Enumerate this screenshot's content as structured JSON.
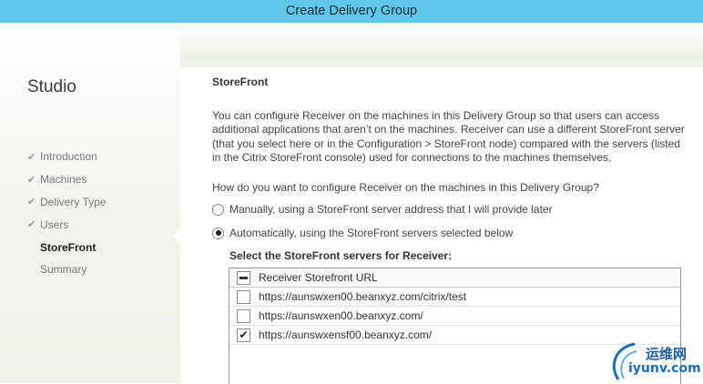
{
  "window": {
    "title": "Create Delivery Group"
  },
  "sidebar": {
    "app_name": "Studio",
    "steps": [
      {
        "label": "Introduction",
        "done": true
      },
      {
        "label": "Machines",
        "done": true
      },
      {
        "label": "Delivery Type",
        "done": true
      },
      {
        "label": "Users",
        "done": true
      },
      {
        "label": "StoreFront",
        "done": false,
        "current": true
      },
      {
        "label": "Summary",
        "done": false
      }
    ]
  },
  "main": {
    "section_title": "StoreFront",
    "description": "You can configure Receiver on the machines in this Delivery Group so that users can access additional applications that aren’t on the machines. Receiver can use a different StoreFront server (that you select here or in the Configuration > StoreFront node) compared with the servers (listed in the Citrix StoreFront console) used for connections to the machines themselves.",
    "question": "How do you want to configure Receiver on the machines in this Delivery Group?",
    "options": [
      {
        "label": "Manually, using a StoreFront server address that I will provide later",
        "selected": false
      },
      {
        "label": "Automatically, using the StoreFront servers selected below",
        "selected": true
      }
    ],
    "select_label": "Select the StoreFront servers for Receiver:",
    "list": {
      "header": "Receiver Storefront URL",
      "rows": [
        {
          "url": "https://aunswxen00.beanxyz.com/citrix/test",
          "checked": false
        },
        {
          "url": "https://aunswxen00.beanxyz.com/",
          "checked": false
        },
        {
          "url": "https://aunswxensf00.beanxyz.com/",
          "checked": true
        }
      ]
    }
  },
  "watermark": {
    "cn": "运维网",
    "en": "iyunv.com"
  },
  "colors": {
    "titlebar": "#5fc8ea",
    "logo_blue": "#1b6fb8"
  }
}
